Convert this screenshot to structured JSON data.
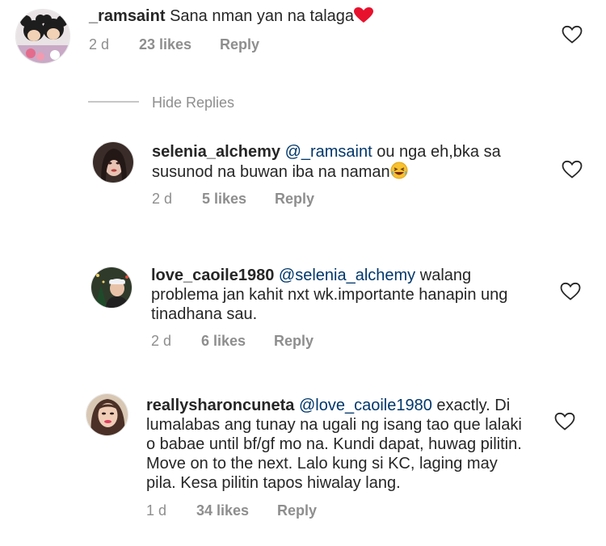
{
  "comments": [
    {
      "username": "_ramsaint",
      "text": "Sana nman yan na talaga",
      "time": "2 d",
      "likes": "23 likes",
      "reply": "Reply"
    },
    {
      "username": "selenia_alchemy",
      "mention": "@_ramsaint",
      "text_line1": "ou nga eh,bka sa",
      "text_line2": "susunod na buwan iba na naman",
      "time": "2 d",
      "likes": "5 likes",
      "reply": "Reply"
    },
    {
      "username": "love_caoile1980",
      "mention": "@selenia_alchemy",
      "text_line1": "walang",
      "text_line2": "problema jan kahit nxt wk.importante hanapin ung",
      "text_line3": "tinadhana sau.",
      "time": "2 d",
      "likes": "6 likes",
      "reply": "Reply"
    },
    {
      "username": "reallysharoncuneta",
      "mention": "@love_caoile1980",
      "text_line1": "exactly. Di",
      "text_line2": "lumalabas ang tunay na ugali ng isang tao que lalaki",
      "text_line3": "o babae until bf/gf mo na. Kundi dapat, huwag pilitin.",
      "text_line4": "Move on to the next. Lalo kung si KC, laging may",
      "text_line5": "pila. Kesa pilitin tapos hiwalay lang.",
      "time": "1 d",
      "likes": "34 likes",
      "reply": "Reply"
    }
  ],
  "hide_replies": "Hide Replies",
  "colors": {
    "text": "#262626",
    "mention": "#00376b",
    "meta": "#8e8e8e",
    "heart_red": "#ed4956"
  },
  "icons": [
    "heart-icon",
    "red-heart-emoji",
    "laughing-emoji"
  ]
}
